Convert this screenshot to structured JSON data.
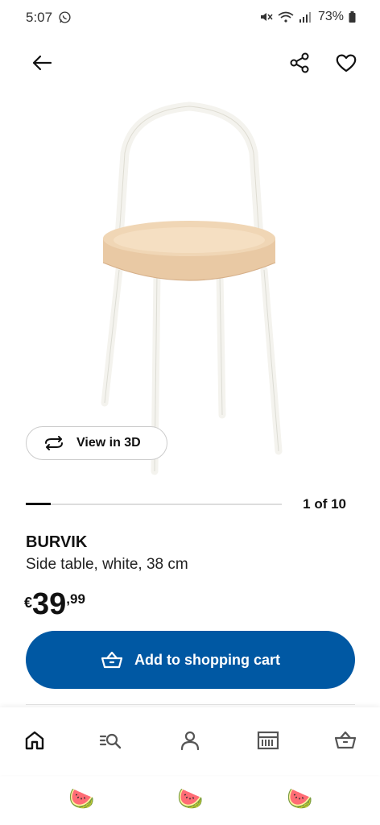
{
  "status_bar": {
    "time": "5:07",
    "battery": "73%"
  },
  "view_3d": {
    "label": "View in 3D"
  },
  "carousel": {
    "counter": "1 of 10",
    "current": 1,
    "total": 10
  },
  "product": {
    "name": "BURVIK",
    "description": "Side table, white, 38 cm",
    "price_currency": "€",
    "price_integer": "39",
    "price_decimal": ",99"
  },
  "cart_button": {
    "label": "Add to shopping cart"
  },
  "bottom_nav": {
    "items": [
      "home-icon",
      "search-list-icon",
      "profile-icon",
      "store-icon",
      "cart-icon"
    ]
  },
  "emoji_suggestions": [
    "🍉",
    "🍉",
    "🍉"
  ],
  "colors": {
    "brand_blue": "#0058a3",
    "text": "#111111"
  }
}
